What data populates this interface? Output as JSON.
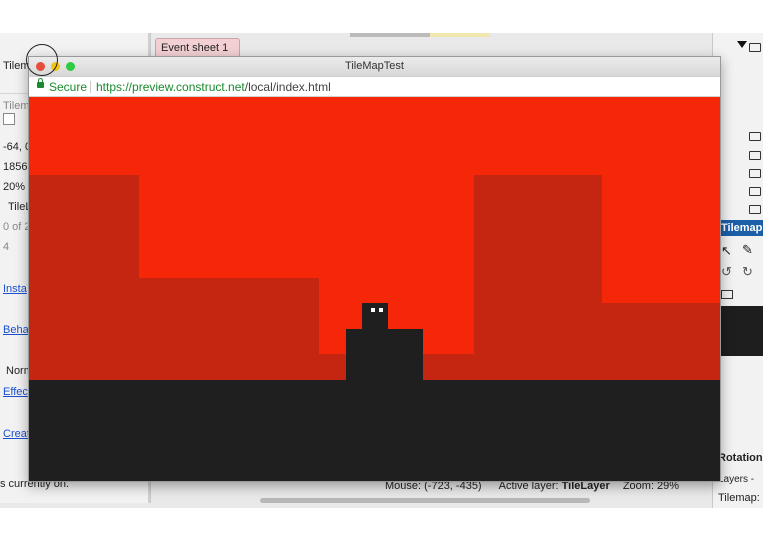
{
  "editor": {
    "left_panel": {
      "title_partial": "Tilem",
      "subtitle_partial": "Tilem",
      "coords_partial": "-64, 0",
      "size_partial": "1856",
      "zoom_partial": "20%",
      "layer_partial": "TileL",
      "count_partial": "0 of 2",
      "value_4": "4",
      "link_instance": "Insta",
      "link_behaviors": "Beha",
      "normal_partial": "Norm",
      "link_effects": "Effec",
      "link_create": "Creat"
    },
    "tab_event_sheet": "Event sheet 1",
    "tab_close": "×",
    "right_panel": {
      "tilemap_title": "Tilemap: T",
      "rotation_label": "Rotation",
      "layers_label": "Layers -",
      "tilemap_bottom": "Tilemap:"
    },
    "status": {
      "left_text": "s currently on.",
      "mouse_label": "Mouse: (-723, -435)",
      "active_layer_label": "Active layer:",
      "active_layer_value": "TileLayer",
      "zoom_label": "Zoom: 29%"
    }
  },
  "preview": {
    "window_title": "TileMapTest",
    "secure_label": "Secure",
    "url_host": "https://preview.construct.net",
    "url_path": "/local/index.html"
  },
  "colors": {
    "sky": "#f62608",
    "hills": "#c42611",
    "ground": "#1f1f1f",
    "tab_pink": "#f3d0d3",
    "tilemap_header": "#1b5fa8",
    "secure_green": "#1a8a2e"
  },
  "icons": [
    "close-traffic-light-icon",
    "minimize-traffic-light-icon",
    "zoom-traffic-light-icon",
    "lock-icon",
    "folder-icon",
    "pointer-icon",
    "pencil-icon",
    "rotate-left-icon",
    "rotate-right-icon",
    "chevron-down-icon"
  ]
}
